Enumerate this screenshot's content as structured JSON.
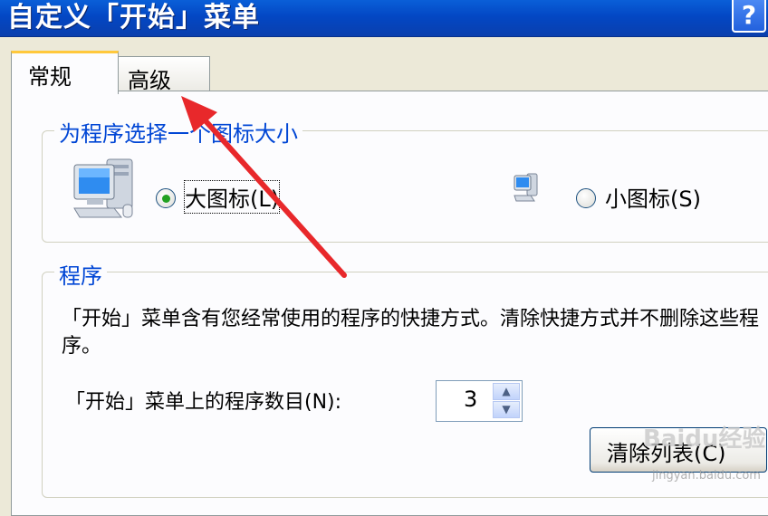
{
  "window": {
    "title": "自定义「开始」菜单",
    "help_label": "?"
  },
  "tabs": [
    {
      "label": "常规",
      "active": true
    },
    {
      "label": "高级",
      "active": false
    }
  ],
  "icon_size_group": {
    "legend": "为程序选择一个图标大小",
    "options": [
      {
        "label": "大图标(L)",
        "icon": "large-computer-icon",
        "selected": true
      },
      {
        "label": "小图标(S)",
        "icon": "small-computer-icon",
        "selected": false
      }
    ]
  },
  "programs_group": {
    "legend": "程序",
    "description": "「开始」菜单含有您经常使用的程序的快捷方式。清除快捷方式并不删除这些程序。",
    "count_label": "「开始」菜单上的程序数目(N):",
    "count_value": "3",
    "clear_button": "清除列表(C)"
  },
  "watermark": {
    "logo": "Baidu经验",
    "url": "jingyan.baidu.com"
  },
  "colors": {
    "titlebar": "#0347c4",
    "legend_text": "#0046d5",
    "annotation_arrow": "#e8282b",
    "radio_selected": "#21a121"
  }
}
